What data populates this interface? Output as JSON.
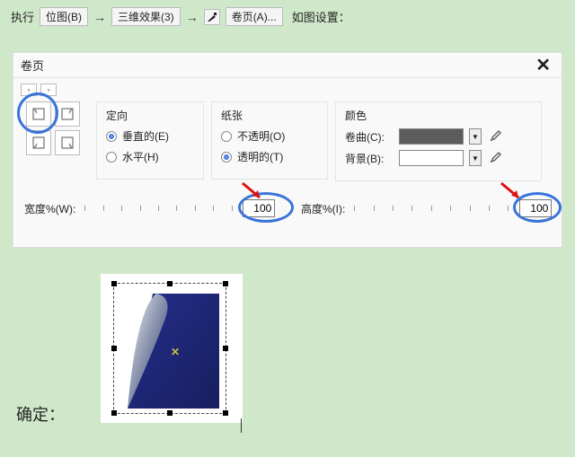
{
  "topline": {
    "exec": "执行",
    "menu1": "位图(B)",
    "menu2": "三维效果(3)",
    "menu3": "卷页(A)...",
    "after": "如图设置："
  },
  "dialog": {
    "title": "卷页",
    "groups": {
      "orient": {
        "title": "定向",
        "vertical": "垂直的(E)",
        "horizontal": "水平(H)"
      },
      "paper": {
        "title": "纸张",
        "opaque": "不透明(O)",
        "transparent": "透明的(T)"
      },
      "color": {
        "title": "颜色",
        "curl": "卷曲(C):",
        "bg": "背景(B):"
      }
    },
    "sliders": {
      "width_label": "宽度%(W):",
      "height_label": "高度%(I):",
      "width_value": "100",
      "height_value": "100"
    }
  },
  "bottom_label": "确定："
}
